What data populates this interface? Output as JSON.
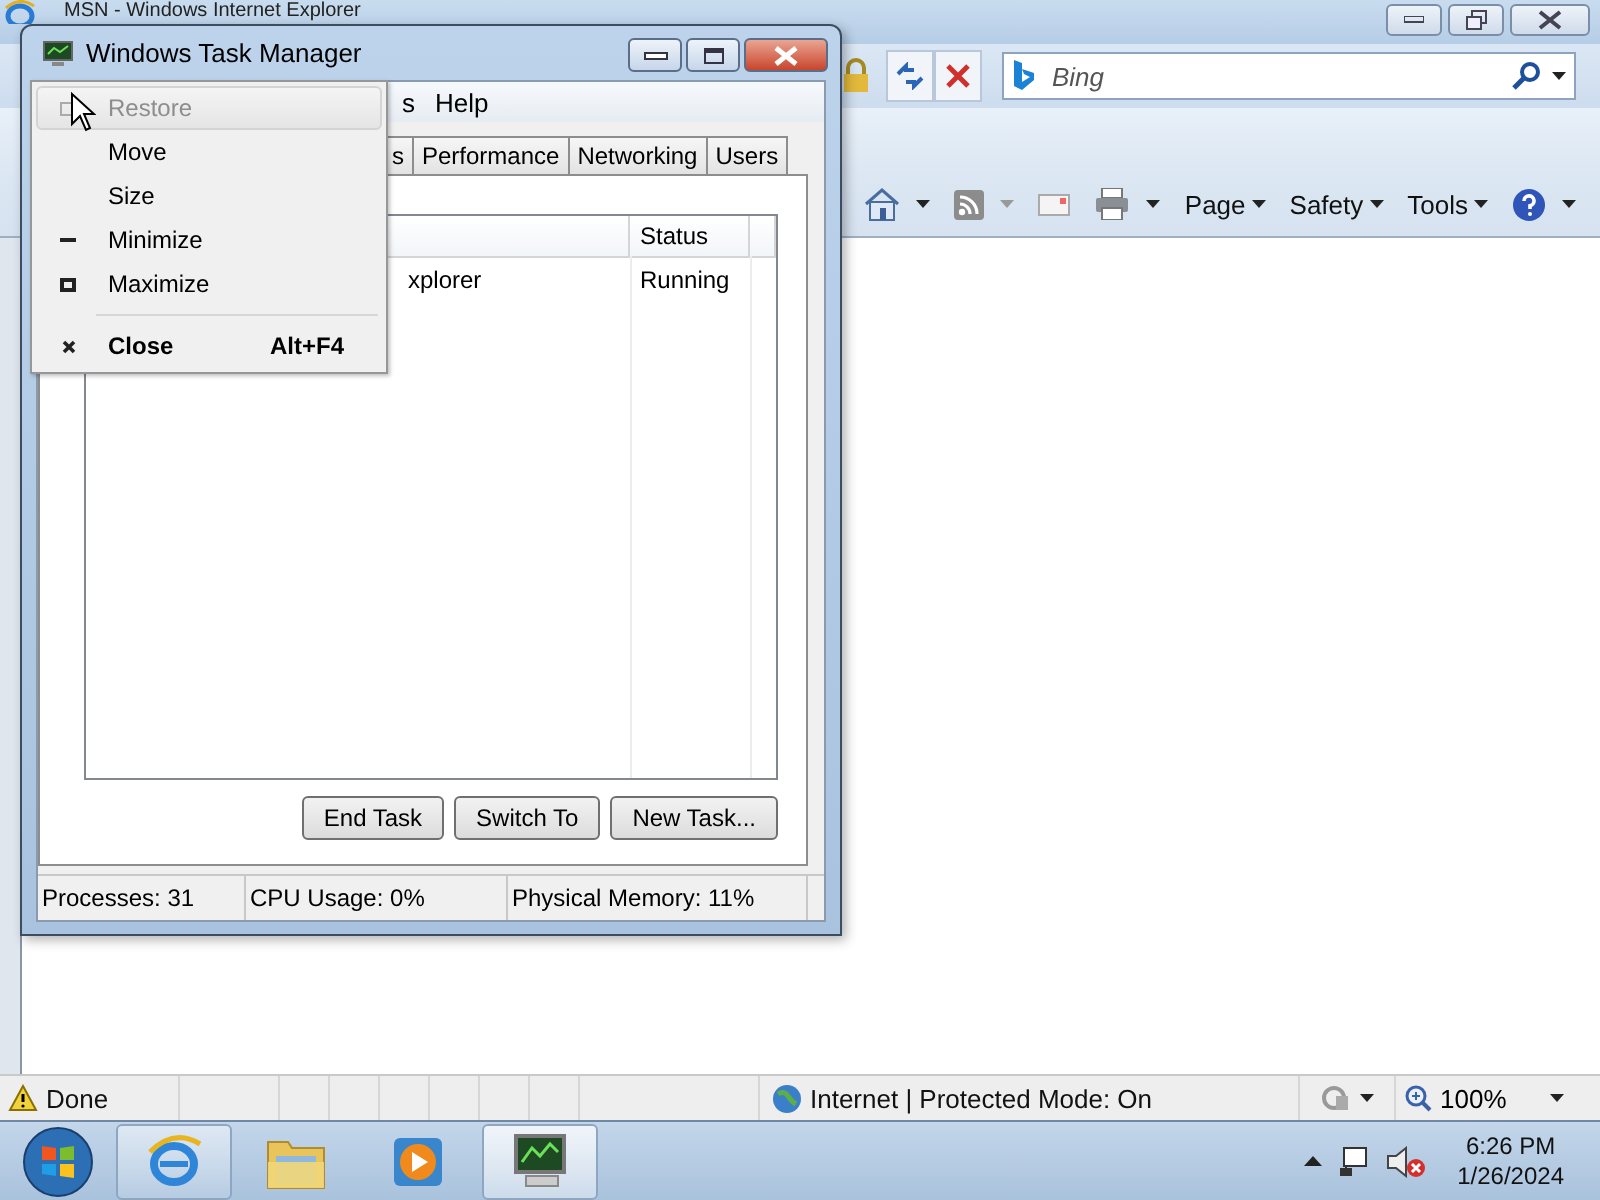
{
  "ie_window": {
    "title": "MSN - Windows Internet Explorer",
    "search": {
      "placeholder": "Bing"
    },
    "command_menus": [
      "Page",
      "Safety",
      "Tools"
    ],
    "status_bar": {
      "text": "Done",
      "zone": "Internet | Protected Mode: On",
      "zoom": "100%"
    }
  },
  "task_manager": {
    "title": "Windows Task Manager",
    "menu_bar": [
      "s",
      "Help"
    ],
    "tabs": [
      {
        "label": "s",
        "selected": false
      },
      {
        "label": "Performance",
        "selected": false
      },
      {
        "label": "Networking",
        "selected": false
      },
      {
        "label": "Users",
        "selected": false
      }
    ],
    "table": {
      "columns": [
        "Status"
      ],
      "rows": [
        {
          "task": "xplorer",
          "status": "Running"
        }
      ]
    },
    "buttons": [
      "End Task",
      "Switch To",
      "New Task..."
    ],
    "status_bar": [
      "Processes: 31",
      "CPU Usage: 0%",
      "Physical Memory: 11%"
    ]
  },
  "window_menu": {
    "items": [
      {
        "kind": "restore",
        "label": "Restore",
        "disabled": true,
        "selected": true
      },
      {
        "kind": "plain",
        "label": "Move",
        "disabled": false,
        "selected": false
      },
      {
        "kind": "plain",
        "label": "Size",
        "disabled": false,
        "selected": false
      },
      {
        "kind": "minimize",
        "label": "Minimize",
        "disabled": false,
        "selected": false
      },
      {
        "kind": "maximize",
        "label": "Maximize",
        "disabled": false,
        "selected": false
      },
      {
        "kind": "separator"
      },
      {
        "kind": "close",
        "label": "Close",
        "shortcut": "Alt+F4",
        "default": true,
        "disabled": false,
        "selected": false
      }
    ]
  },
  "taskbar": {
    "buttons": [
      {
        "kind": "ie",
        "running": true,
        "selected": false
      },
      {
        "kind": "folder",
        "running": false,
        "selected": false
      },
      {
        "kind": "media",
        "running": false,
        "selected": false
      },
      {
        "kind": "taskmgr",
        "running": true,
        "selected": true
      }
    ],
    "clock": {
      "time": "6:26 PM",
      "date": "1/26/2024"
    }
  }
}
